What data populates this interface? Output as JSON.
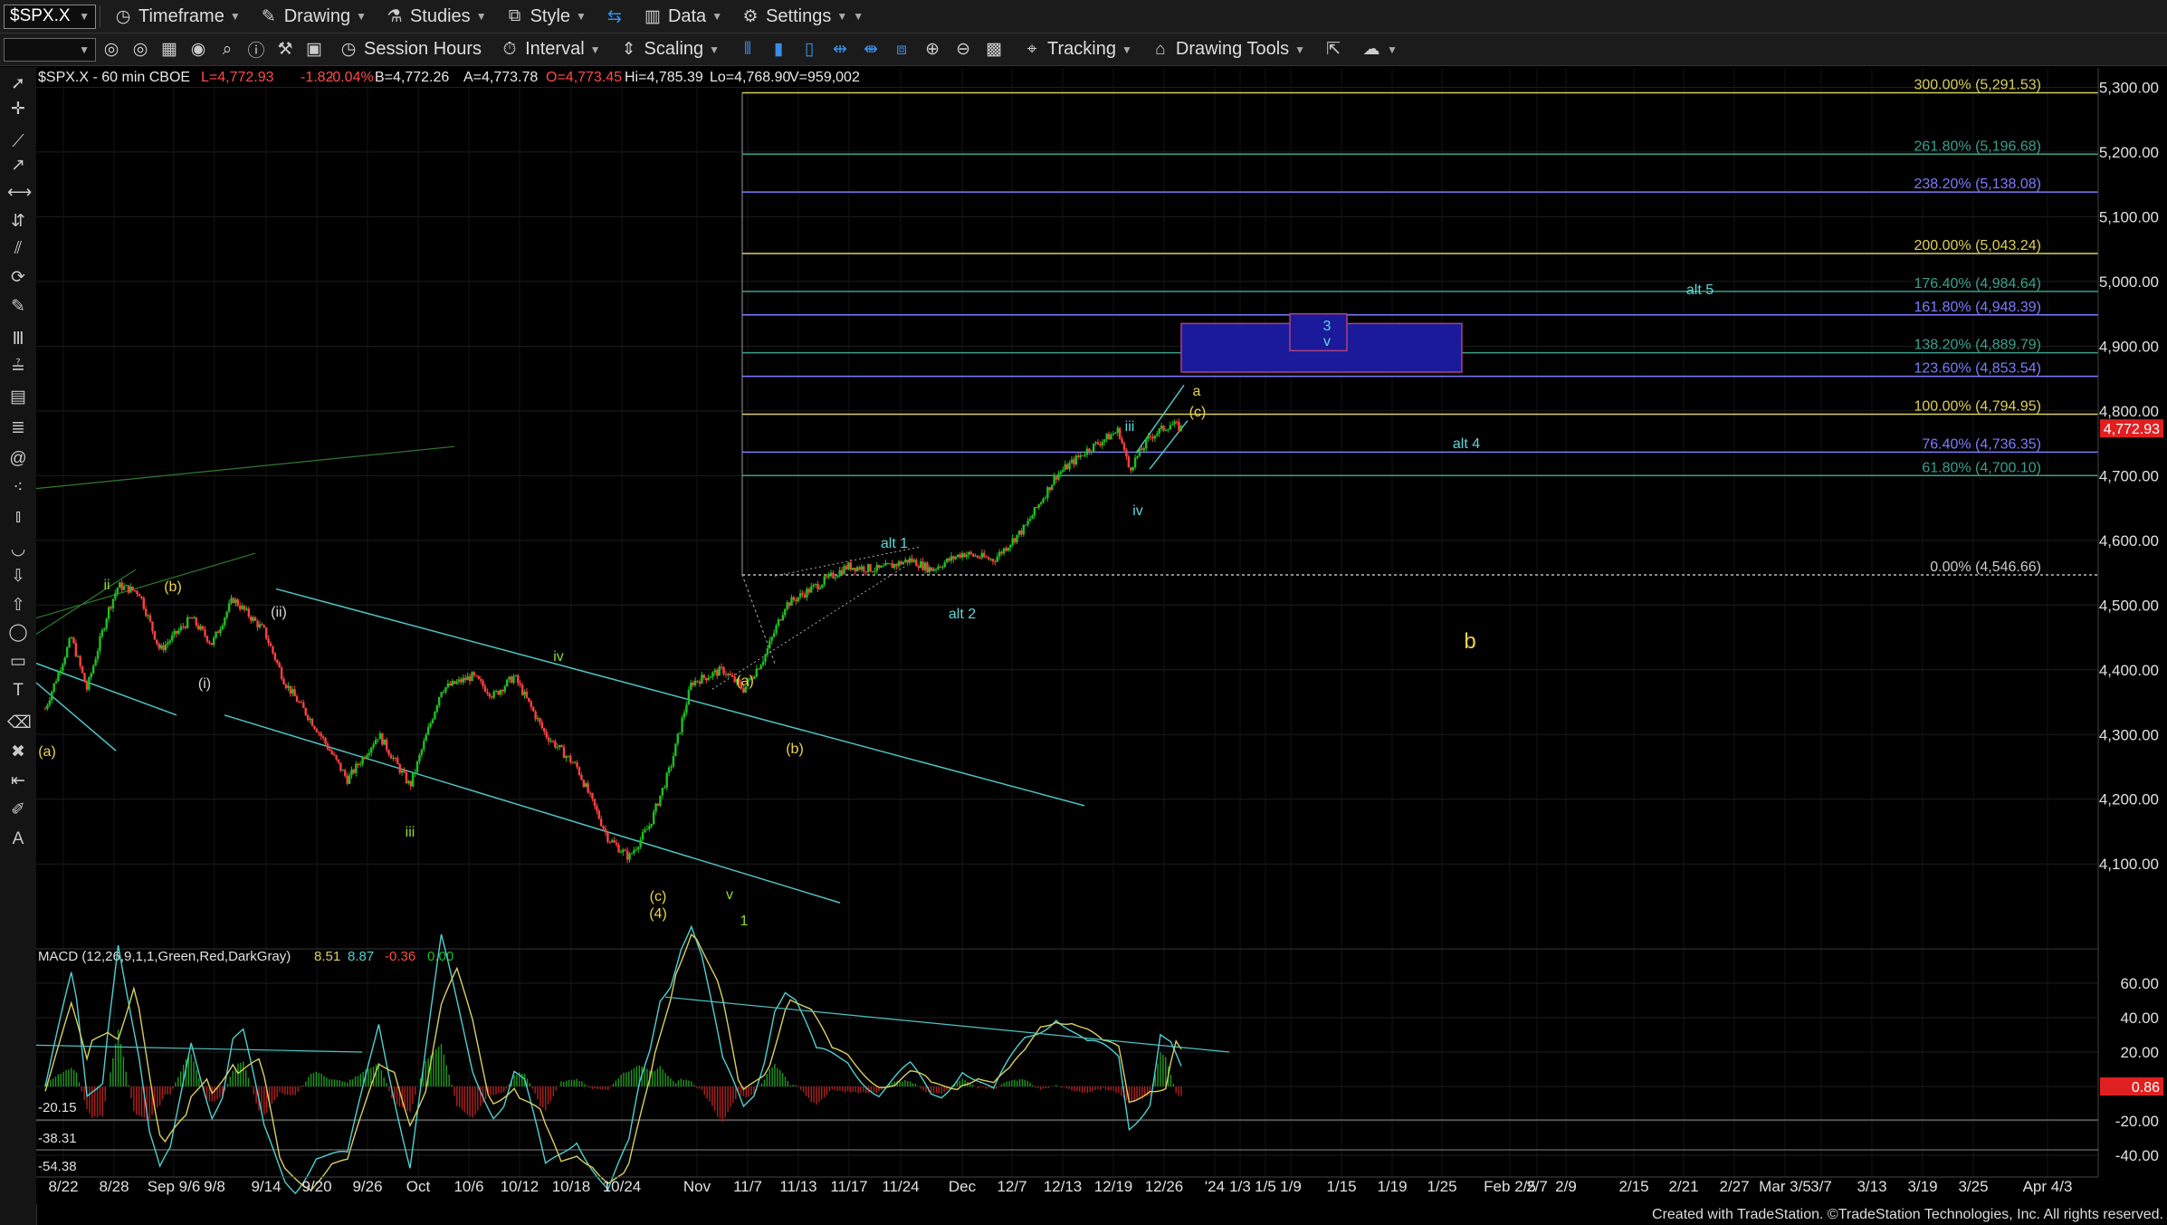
{
  "toolbar1": {
    "symbol": "$SPX.X",
    "items": [
      "Timeframe",
      "Drawing",
      "Studies",
      "Style",
      "Data",
      "Settings"
    ]
  },
  "toolbar2": {
    "items": [
      "Session Hours",
      "Interval",
      "Scaling",
      "Tracking",
      "Drawing Tools"
    ]
  },
  "colors": {
    "bg": "#000000",
    "up": "#1fc01f",
    "down": "#ff4040",
    "fib": "#d8d060",
    "channel": "#4fc3c3",
    "box": "#1a1a9a",
    "label_yellow": "#e8d44a",
    "label_cyan": "#5fd7d7",
    "label_green": "#8fd92f"
  },
  "chart_data": {
    "type": "candlestick",
    "header": {
      "title": "$SPX.X - 60 min  CBOE",
      "L": "L=4,772.93",
      "chg": "-1.82",
      "pct": "-0.04%",
      "B": "B=4,772.26",
      "A": "A=4,773.78",
      "O": "O=4,773.45",
      "Hi": "Hi=4,785.39",
      "Lo": "Lo=4,768.90",
      "V": "V=959,002"
    },
    "price_axis": {
      "min": 3980,
      "max": 5330,
      "ticks": [
        4100,
        4200,
        4300,
        4400,
        4500,
        4600,
        4700,
        4800,
        4900,
        5000,
        5100,
        5200,
        5300
      ],
      "tick_labels": [
        "4,100.00",
        "4,200.00",
        "4,300.00",
        "4,400.00",
        "4,500.00",
        "4,600.00",
        "4,700.00",
        "4,800.00",
        "4,900.00",
        "5,000.00",
        "5,100.00",
        "5,200.00",
        "5,300.00"
      ],
      "last_price": "4,772.93"
    },
    "date_labels": [
      "8/22",
      "8/28",
      "Sep 9/6",
      "9/8",
      "9/14",
      "9/20",
      "9/26",
      "Oct",
      "10/6",
      "10/12",
      "10/18",
      "10/24",
      "Nov",
      "11/7",
      "11/13",
      "11/17",
      "11/24",
      "Dec",
      "12/7",
      "12/13",
      "12/19",
      "12/26",
      "'24",
      "1/3",
      "1/5",
      "1/9",
      "1/15",
      "1/19",
      "1/25",
      "Feb 2/5",
      "2/7",
      "2/9",
      "2/15",
      "2/21",
      "2/27",
      "Mar 3/5",
      "3/7",
      "3/13",
      "3/19",
      "3/25",
      "Apr 4/3"
    ],
    "price_path": [
      {
        "d": 0,
        "p": 4340
      },
      {
        "d": 5,
        "p": 4450
      },
      {
        "d": 8,
        "p": 4370
      },
      {
        "d": 12,
        "p": 4490
      },
      {
        "d": 14,
        "p": 4530
      },
      {
        "d": 18,
        "p": 4520
      },
      {
        "d": 22,
        "p": 4430
      },
      {
        "d": 28,
        "p": 4480
      },
      {
        "d": 32,
        "p": 4440
      },
      {
        "d": 36,
        "p": 4510
      },
      {
        "d": 42,
        "p": 4460
      },
      {
        "d": 46,
        "p": 4380
      },
      {
        "d": 52,
        "p": 4310
      },
      {
        "d": 58,
        "p": 4230
      },
      {
        "d": 64,
        "p": 4300
      },
      {
        "d": 70,
        "p": 4220
      },
      {
        "d": 76,
        "p": 4370
      },
      {
        "d": 82,
        "p": 4390
      },
      {
        "d": 86,
        "p": 4360
      },
      {
        "d": 90,
        "p": 4390
      },
      {
        "d": 96,
        "p": 4300
      },
      {
        "d": 102,
        "p": 4250
      },
      {
        "d": 108,
        "p": 4140
      },
      {
        "d": 112,
        "p": 4110
      },
      {
        "d": 116,
        "p": 4160
      },
      {
        "d": 120,
        "p": 4250
      },
      {
        "d": 124,
        "p": 4380
      },
      {
        "d": 130,
        "p": 4400
      },
      {
        "d": 134,
        "p": 4370
      },
      {
        "d": 138,
        "p": 4420
      },
      {
        "d": 142,
        "p": 4500
      },
      {
        "d": 148,
        "p": 4530
      },
      {
        "d": 154,
        "p": 4560
      },
      {
        "d": 160,
        "p": 4555
      },
      {
        "d": 166,
        "p": 4570
      },
      {
        "d": 170,
        "p": 4555
      },
      {
        "d": 176,
        "p": 4580
      },
      {
        "d": 182,
        "p": 4570
      },
      {
        "d": 188,
        "p": 4620
      },
      {
        "d": 194,
        "p": 4700
      },
      {
        "d": 200,
        "p": 4740
      },
      {
        "d": 206,
        "p": 4770
      },
      {
        "d": 208,
        "p": 4710
      },
      {
        "d": 212,
        "p": 4760
      },
      {
        "d": 216,
        "p": 4780
      },
      {
        "d": 218,
        "p": 4773
      }
    ],
    "fib_levels": [
      {
        "label": "300.00% (5,291.53)",
        "price": 5291.53
      },
      {
        "label": "261.80% (5,196.68)",
        "price": 5196.68
      },
      {
        "label": "238.20% (5,138.08)",
        "price": 5138.08
      },
      {
        "label": "200.00% (5,043.24)",
        "price": 5043.24
      },
      {
        "label": "176.40% (4,984.64)",
        "price": 4984.64
      },
      {
        "label": "161.80% (4,948.39)",
        "price": 4948.39
      },
      {
        "label": "138.20% (4,889.79)",
        "price": 4889.79
      },
      {
        "label": "123.60% (4,853.54)",
        "price": 4853.54
      },
      {
        "label": "100.00% (4,794.95)",
        "price": 4794.95
      },
      {
        "label": "76.40% (4,736.35)",
        "price": 4736.35
      },
      {
        "label": "61.80% (4,700.10)",
        "price": 4700.1
      },
      {
        "label": "0.00% (4,546.66)",
        "price": 4546.66
      }
    ],
    "wave_labels": [
      {
        "t": "(a)",
        "c": "yellow"
      },
      {
        "t": "ii",
        "c": "green"
      },
      {
        "t": "(b)",
        "c": "yellow"
      },
      {
        "t": "(i)",
        "c": "white"
      },
      {
        "t": "(ii)",
        "c": "white"
      },
      {
        "t": "iii",
        "c": "green"
      },
      {
        "t": "iv",
        "c": "green"
      },
      {
        "t": "(c)",
        "c": "yellow"
      },
      {
        "t": "(4)",
        "c": "yellow"
      },
      {
        "t": "v",
        "c": "green"
      },
      {
        "t": "1",
        "c": "green"
      },
      {
        "t": "(a)",
        "c": "yellow"
      },
      {
        "t": "(b)",
        "c": "yellow"
      },
      {
        "t": "alt 1",
        "c": "cyan"
      },
      {
        "t": "alt 2",
        "c": "cyan"
      },
      {
        "t": "iii",
        "c": "cyan"
      },
      {
        "t": "iv",
        "c": "cyan"
      },
      {
        "t": "a",
        "c": "yellow"
      },
      {
        "t": "(c)",
        "c": "yellow"
      },
      {
        "t": "3",
        "c": "cyan"
      },
      {
        "t": "v",
        "c": "cyan"
      },
      {
        "t": "alt 4",
        "c": "cyan"
      },
      {
        "t": "alt 5",
        "c": "cyan"
      },
      {
        "t": "b",
        "c": "yellow"
      }
    ],
    "macd": {
      "title": "MACD (12,26,9,1,1,Green,Red,DarkGray)",
      "v1": "8.51",
      "v2": "8.87",
      "v3": "-0.36",
      "v4": "0.00",
      "ticks": [
        60,
        40,
        20,
        0,
        -20,
        -40
      ],
      "tick_labels": [
        "60.00",
        "40.00",
        "20.00",
        "",
        "-20.00",
        "-40.00"
      ],
      "left_labels": [
        "-20.15",
        "-38.31",
        "-54.38"
      ],
      "last_value": "0.86"
    }
  },
  "footer": "Created with TradeStation. ©TradeStation Technologies, Inc. All rights reserved."
}
